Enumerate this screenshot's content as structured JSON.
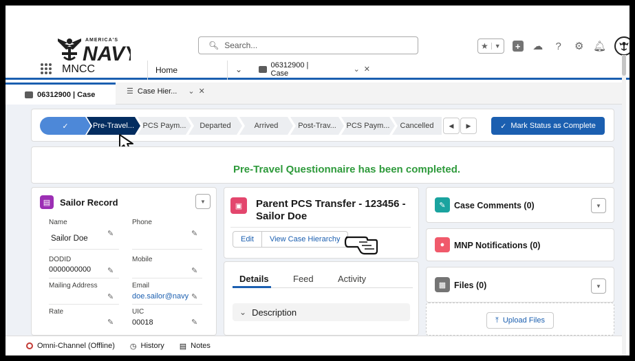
{
  "header": {
    "logo_text": "AMERICA'S NAVY",
    "search_placeholder": "Search..."
  },
  "nav": {
    "app_name": "MNCC",
    "home_label": "Home",
    "tab_label": "06312900 | Case"
  },
  "subtabs": {
    "case_label": "06312900 | Case",
    "hierarchy_label": "Case Hier..."
  },
  "path": {
    "steps": [
      "",
      "Pre-Travel...",
      "PCS Paym...",
      "Departed",
      "Arrived",
      "Post-Trav...",
      "PCS Paym...",
      "Cancelled"
    ],
    "mark_complete_label": "Mark Status as Complete"
  },
  "message": "Pre-Travel Questionnaire has been completed.",
  "sailor_record": {
    "title": "Sailor Record",
    "fields": {
      "name_label": "Name",
      "name_value": "Sailor Doe",
      "phone_label": "Phone",
      "phone_value": "",
      "dodid_label": "DODID",
      "dodid_value": "0000000000",
      "mobile_label": "Mobile",
      "mobile_value": "",
      "mailing_label": "Mailing Address",
      "mailing_value": "",
      "email_label": "Email",
      "email_value": "doe.sailor@navy",
      "rate_label": "Rate",
      "rate_value": "",
      "uic_label": "UIC",
      "uic_value": "00018"
    }
  },
  "case_header": {
    "title_line1": "Parent PCS Transfer - 123456 -",
    "title_line2": "Sailor Doe",
    "edit_label": "Edit",
    "hierarchy_label": "View Case Hierarchy"
  },
  "detail_tabs": {
    "details": "Details",
    "feed": "Feed",
    "activity": "Activity",
    "description_label": "Description"
  },
  "right_cards": {
    "case_comments": "Case Comments (0)",
    "mnp_notifications": "MNP Notifications (0)",
    "files": "Files (0)",
    "upload_label": "Upload Files"
  },
  "colors": {
    "brand_blue": "#1b5fb0",
    "path_current": "#032d60",
    "success_green": "#2e9a3b",
    "sailor_icon": "#9c2fb4",
    "case_icon": "#e3466d",
    "comments_icon": "#1aa39f",
    "notify_icon": "#f05a6b",
    "files_icon": "#747474"
  },
  "footer": {
    "omni": "Omni-Channel (Offline)",
    "history": "History",
    "notes": "Notes"
  }
}
